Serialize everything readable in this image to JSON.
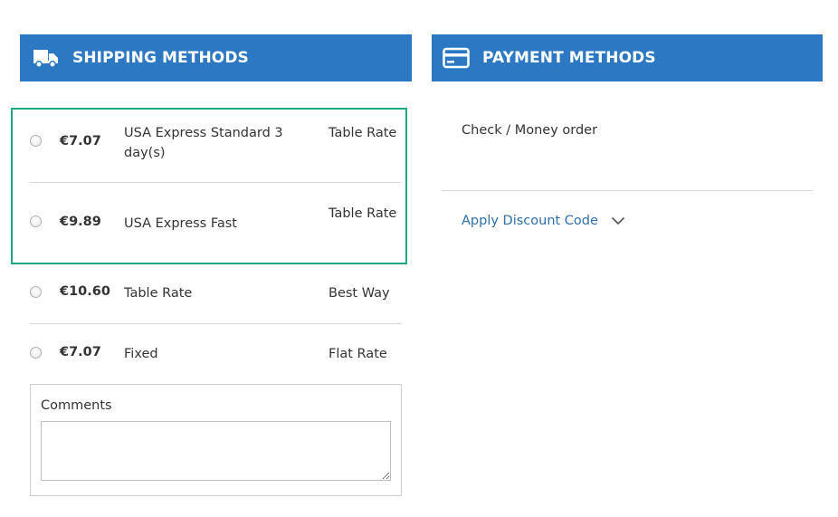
{
  "shipping": {
    "title": "SHIPPING METHODS",
    "methods": [
      {
        "price": "€7.07",
        "method": "USA Express Standard 3 day(s)",
        "carrier": "Table Rate"
      },
      {
        "price": "€9.89",
        "method": "USA Express Fast",
        "carrier": "Table Rate"
      },
      {
        "price": "€10.60",
        "method": "Table Rate",
        "carrier": "Best Way"
      },
      {
        "price": "€7.07",
        "method": "Fixed",
        "carrier": "Flat Rate"
      }
    ],
    "comments_label": "Comments",
    "comments_value": ""
  },
  "payment": {
    "title": "PAYMENT METHODS",
    "option": "Check / Money order",
    "discount_label": "Apply Discount Code"
  },
  "colors": {
    "header_bg": "#2d78c2",
    "highlight_border": "#1da88a",
    "link": "#2f6ea6"
  },
  "icons": {
    "shipping": "truck-icon",
    "payment": "credit-card-icon",
    "discount_toggle": "chevron-down-icon"
  }
}
